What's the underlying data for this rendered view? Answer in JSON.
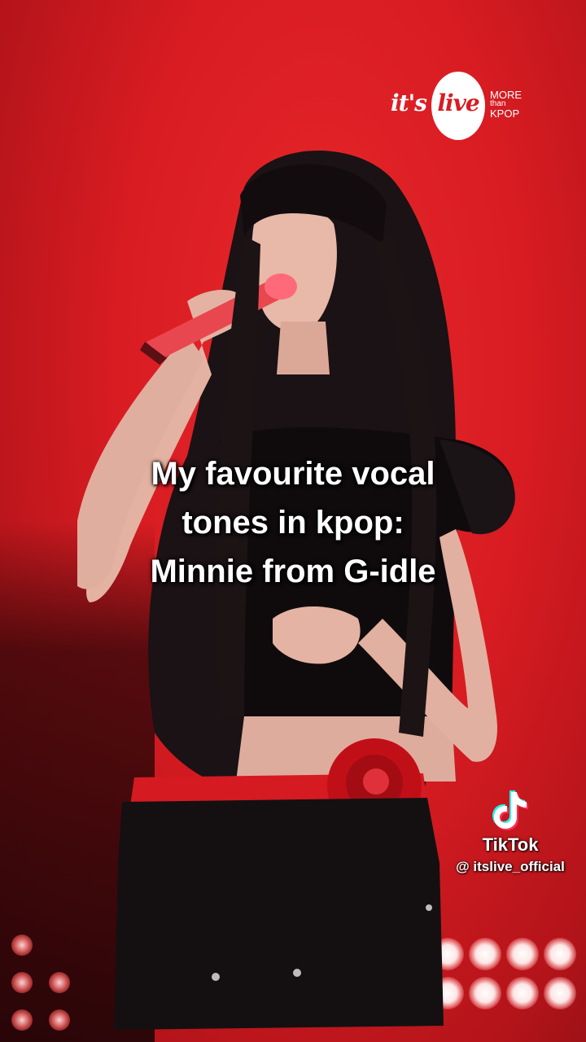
{
  "video": {
    "caption_lines": [
      "My favourite vocal",
      "tones in kpop:",
      "Minnie from G-idle"
    ]
  },
  "logo": {
    "its": "it's",
    "live": "live",
    "more": "MORE",
    "than": "than",
    "kpop": "KPOP"
  },
  "watermark": {
    "app_name": "TikTok",
    "handle": "@ itslive_official",
    "icon": "tiktok-icon"
  },
  "colors": {
    "background": "#d81c22",
    "caption_text": "#ffffff"
  }
}
